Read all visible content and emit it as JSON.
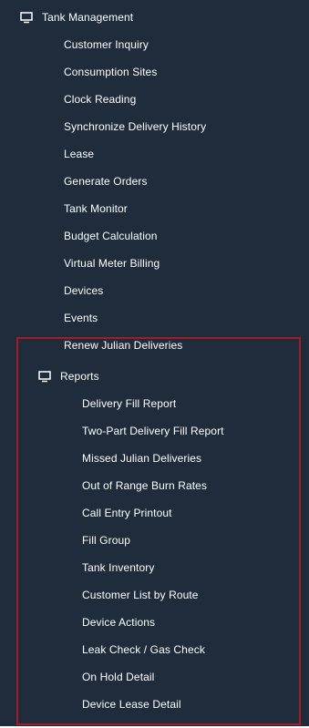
{
  "menu": {
    "tank_management": {
      "label": "Tank Management",
      "icon": "monitor-icon",
      "items": [
        "Customer Inquiry",
        "Consumption Sites",
        "Clock Reading",
        "Synchronize Delivery History",
        "Lease",
        "Generate Orders",
        "Tank Monitor",
        "Budget Calculation",
        "Virtual Meter Billing",
        "Devices",
        "Events",
        "Renew Julian Deliveries"
      ],
      "reports": {
        "label": "Reports",
        "icon": "monitor-icon",
        "items": [
          "Delivery Fill Report",
          "Two-Part Delivery Fill Report",
          "Missed Julian Deliveries",
          "Out of Range Burn Rates",
          "Call Entry Printout",
          "Fill Group",
          "Tank Inventory",
          "Customer List by Route",
          "Device Actions",
          "Leak Check / Gas Check",
          "On Hold Detail",
          "Device Lease Detail"
        ]
      }
    }
  },
  "colors": {
    "background": "#1f2c3c",
    "text": "#ffffff",
    "highlight_border": "#a61a22"
  }
}
